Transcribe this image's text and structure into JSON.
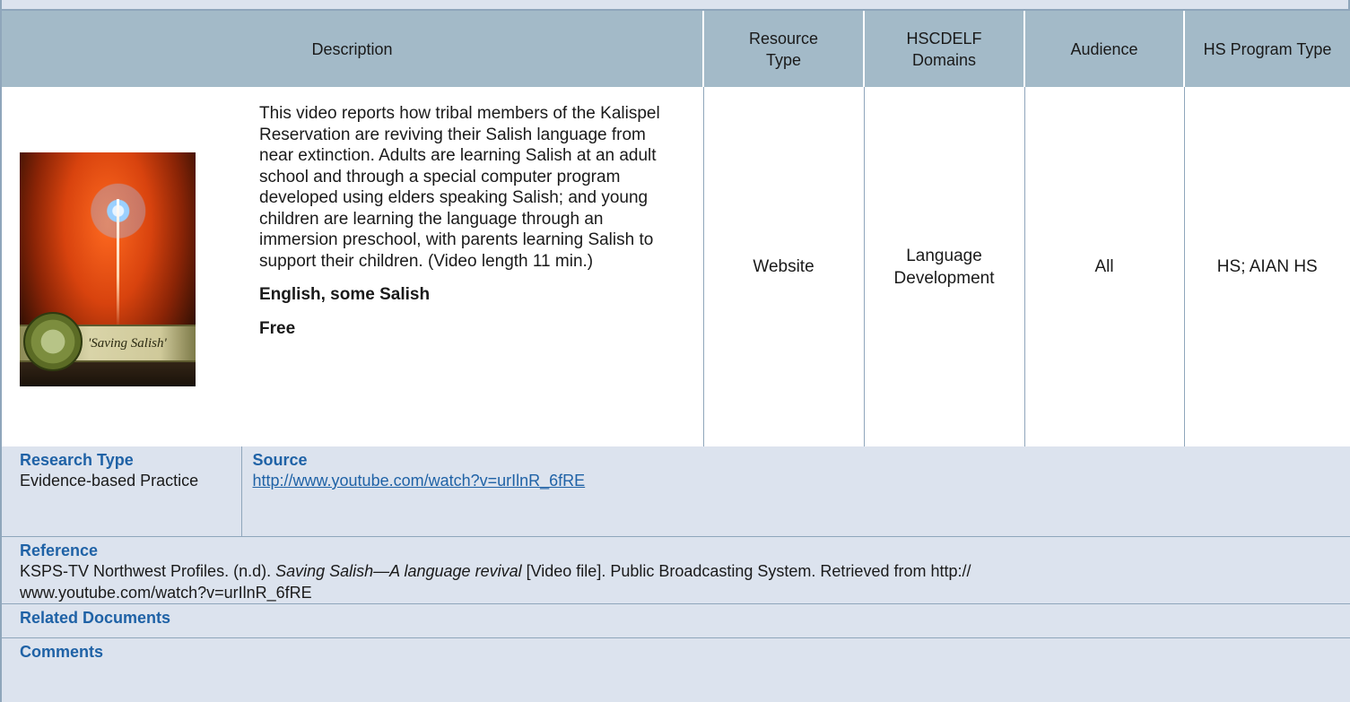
{
  "headers": {
    "description": "Description",
    "resource_type": "Resource Type",
    "domains": "HSCDELF Domains",
    "audience": "Audience",
    "program_type": "HS Program Type"
  },
  "entry": {
    "thumbnail_caption": "'Saving Salish'",
    "description": "This video reports how tribal members of the Kalispel Reservation are reviving their Salish language from near extinction. Adults are learning Salish at an adult school and through a special computer program developed using elders speaking Salish; and young children are learning the language through an immersion preschool, with parents learning Salish to support their children. (Video length 11 min.)",
    "language": "English, some Salish",
    "cost": "Free",
    "resource_type": "Website",
    "domains": "Language Development",
    "audience": "All",
    "program_type": "HS; AIAN HS"
  },
  "research": {
    "label": "Research Type",
    "value": "Evidence-based Practice"
  },
  "source": {
    "label": "Source",
    "link": "http://www.youtube.com/watch?v=urIlnR_6fRE"
  },
  "reference": {
    "label": "Reference",
    "text_before": "KSPS-TV Northwest Profiles. (n.d). ",
    "title_italic": "Saving Salish—A language revival",
    "text_after": " [Video file]. Public Broadcasting System. Retrieved from http:// www.youtube.com/watch?v=urIlnR_6fRE"
  },
  "related": {
    "label": "Related Documents"
  },
  "comments": {
    "label": "Comments"
  }
}
